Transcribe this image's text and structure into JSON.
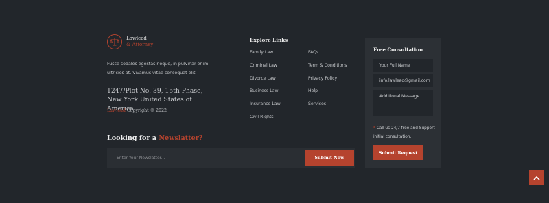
{
  "brand": {
    "name_line1": "Lowlead",
    "name_line2": "& Attorney",
    "about": "Fusce sodales egestas neque, in pulvinar enim ultricies at. Vivamus vitae consequat elit.",
    "address": "1247/Plot No. 39, 15th Phase, New York United States of America.",
    "copyright_brand": "Lawlead",
    "copyright_text": " Copyright © 2022"
  },
  "explore": {
    "title": "Explore Links",
    "col1": [
      "Family Law",
      "Criminal Law",
      "Divorce Law",
      "Business Law",
      "Insurance Law",
      "Civil Rights"
    ],
    "col2": [
      "FAQs",
      "Term & Conditions",
      "Privacy Policy",
      "Help",
      "Services"
    ]
  },
  "newsletter": {
    "title_prefix": "Looking for a ",
    "title_accent": "Newslatter?",
    "placeholder": "Enter Your Newslatter...",
    "button": "Submit Now"
  },
  "consultation": {
    "title": "Free Consultation",
    "name_placeholder": "Your Full Name",
    "email_value": "info.lawlead@gmail.com",
    "message_placeholder": "Additional Message",
    "note_star": "*",
    "note": " Call us 24/7 free and Support initial consultation.",
    "button": "Submit Request"
  },
  "colors": {
    "background": "#22262b",
    "panel": "#2c3035",
    "accent": "#b5432e"
  },
  "icons": {
    "logo": "scales-of-justice-icon",
    "scroll_top": "chevron-up-icon"
  }
}
